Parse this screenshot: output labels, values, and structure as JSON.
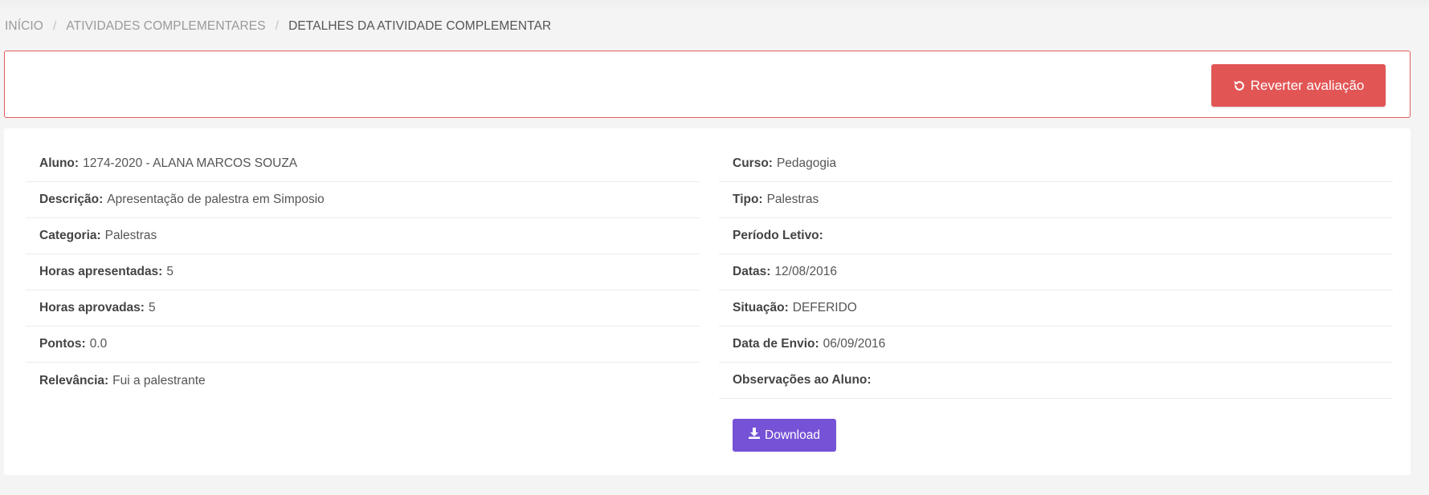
{
  "breadcrumb": {
    "home": "INÍCIO",
    "activities": "ATIVIDADES COMPLEMENTARES",
    "current": "DETALHES DA ATIVIDADE COMPLEMENTAR",
    "separator": "/"
  },
  "actions": {
    "revert_label": "Reverter avaliação",
    "revert_icon": "undo-icon",
    "revert_color": "#e25555"
  },
  "details": {
    "left": [
      {
        "label": "Aluno:",
        "value": "1274-2020 - ALANA MARCOS SOUZA"
      },
      {
        "label": "Descrição:",
        "value": "Apresentação de palestra em Simposio"
      },
      {
        "label": "Categoria:",
        "value": "Palestras"
      },
      {
        "label": "Horas apresentadas:",
        "value": "5"
      },
      {
        "label": "Horas aprovadas:",
        "value": "5"
      },
      {
        "label": "Pontos:",
        "value": "0.0"
      },
      {
        "label": "Relevância:",
        "value": "Fui a palestrante"
      }
    ],
    "right": [
      {
        "label": "Curso:",
        "value": "Pedagogia"
      },
      {
        "label": "Tipo:",
        "value": "Palestras"
      },
      {
        "label": "Período Letivo:",
        "value": ""
      },
      {
        "label": "Datas:",
        "value": "12/08/2016"
      },
      {
        "label": "Situação:",
        "value": "DEFERIDO"
      },
      {
        "label": "Data de Envio:",
        "value": "06/09/2016"
      },
      {
        "label": "Observações ao Aluno:",
        "value": ""
      }
    ]
  },
  "download": {
    "label": "Download",
    "icon": "download-icon",
    "color": "#7652d6"
  }
}
